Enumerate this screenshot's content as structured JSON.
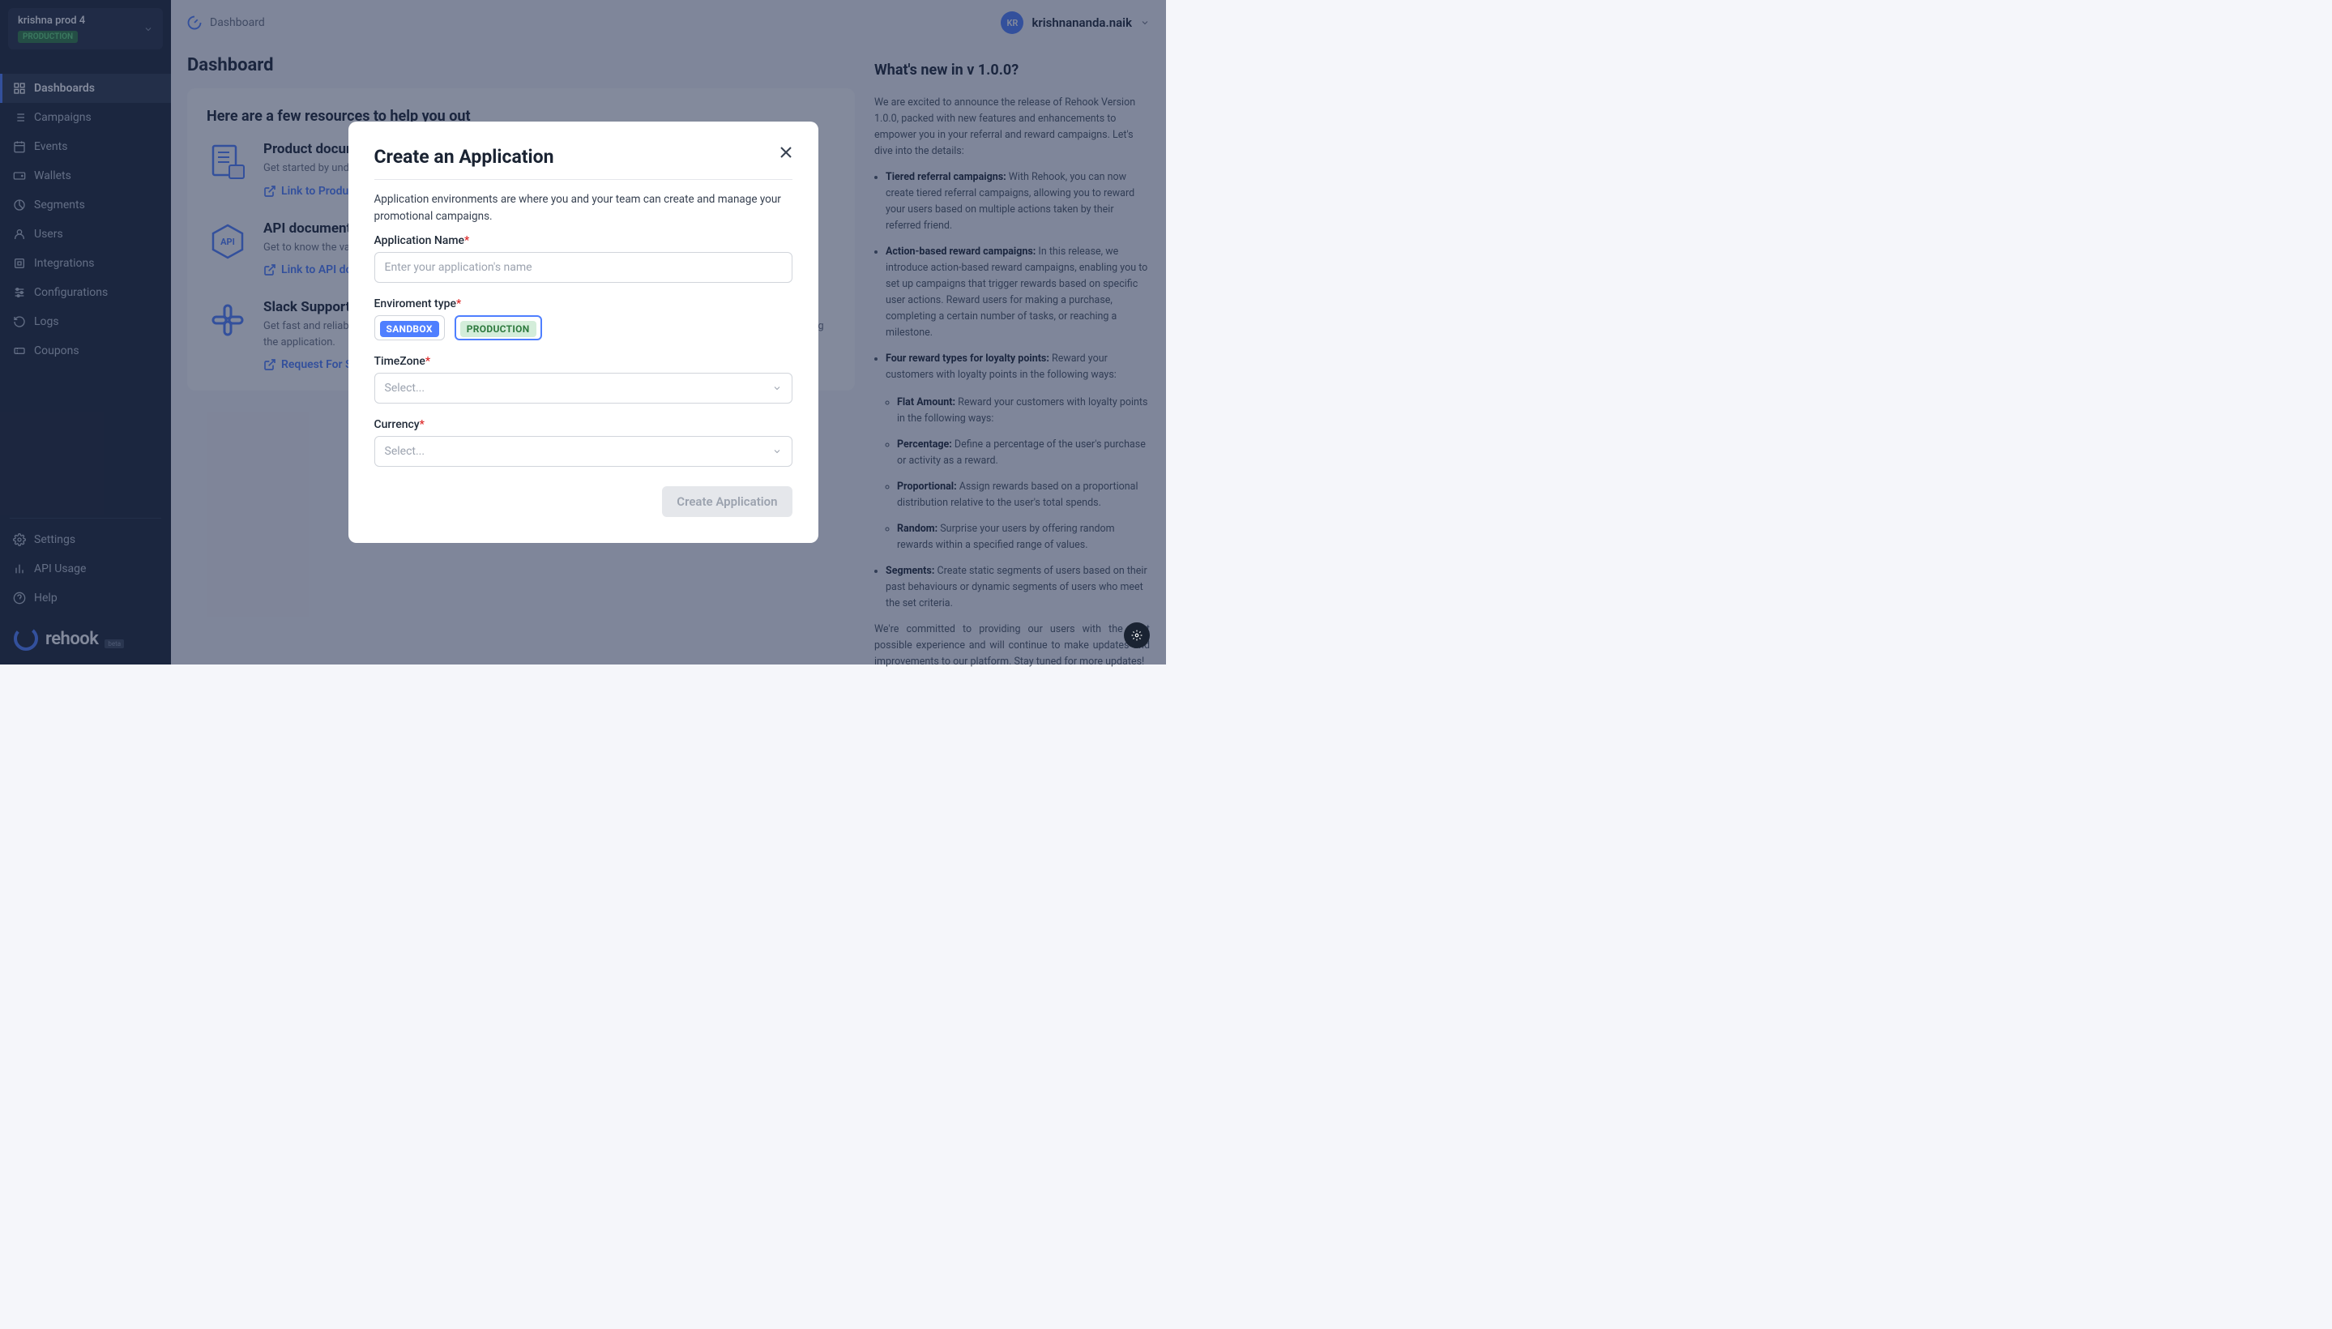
{
  "workspace": {
    "name": "krishna prod 4",
    "env": "PRODUCTION"
  },
  "nav": {
    "items": [
      {
        "label": "Dashboards"
      },
      {
        "label": "Campaigns"
      },
      {
        "label": "Events"
      },
      {
        "label": "Wallets"
      },
      {
        "label": "Segments"
      },
      {
        "label": "Users"
      },
      {
        "label": "Integrations"
      },
      {
        "label": "Configurations"
      },
      {
        "label": "Logs"
      },
      {
        "label": "Coupons"
      }
    ],
    "bottom": [
      {
        "label": "Settings"
      },
      {
        "label": "API Usage"
      },
      {
        "label": "Help"
      }
    ]
  },
  "logo": {
    "text": "rehook",
    "beta": "beta"
  },
  "topbar": {
    "breadcrumb": "Dashboard",
    "user_initials": "KR",
    "user_name": "krishnananda.naik"
  },
  "page": {
    "title": "Dashboard",
    "resources_title": "Here are a few resources to help you out",
    "resources": [
      {
        "title": "Product documentation",
        "desc": "Get started by understanding more about the platform and creating campaigns to start offering rewards.",
        "link": "Link to Product documentation"
      },
      {
        "title": "API documentation",
        "desc": "Get to know the various APIs offered by the platform to push events, check the rewards received, and more.",
        "link": "Link to API documentation"
      },
      {
        "title": "Slack Support",
        "desc": "Get fast and reliable support. Our support team will help you with any blockers or hurdles you may encounter while using the application.",
        "link": "Request For Slack Connect"
      }
    ],
    "news_title": "What's new in v 1.0.0?",
    "news_intro": "We are excited to announce the release of Rehook Version 1.0.0, packed with new features and enhancements to empower you in your referral and reward campaigns. Let's dive into the details:",
    "news_items": [
      {
        "bold": "Tiered referral campaigns:",
        "text": " With Rehook, you can now create tiered referral campaigns, allowing you to reward your users based on multiple actions taken by their referred friend."
      },
      {
        "bold": "Action-based reward campaigns:",
        "text": " In this release, we introduce action-based reward campaigns, enabling you to set up campaigns that trigger rewards based on specific user actions. Reward users for making a purchase, completing a certain number of tasks, or reaching a milestone."
      },
      {
        "bold": "Four reward types for loyalty points:",
        "text": " Reward your customers with loyalty points in the following ways:"
      }
    ],
    "news_sub": [
      {
        "bold": "Flat Amount:",
        "text": " Reward your customers with loyalty points in the following ways:"
      },
      {
        "bold": "Percentage:",
        "text": " Define a percentage of the user's purchase or activity as a reward."
      },
      {
        "bold": "Proportional:",
        "text": " Assign rewards based on a proportional distribution relative to the user's total spends."
      },
      {
        "bold": "Random:",
        "text": " Surprise your users by offering random rewards within a specified range of values."
      }
    ],
    "news_seg": {
      "bold": "Segments:",
      "text": " Create static segments of users based on their past behaviours or dynamic segments of users who meet the set criteria."
    },
    "news_outro": "We're committed to providing our users with the best possible experience and will continue to make updates and improvements to our platform. Stay tuned for more updates!"
  },
  "modal": {
    "title": "Create an Application",
    "desc": "Application environments are where you and your team can create and manage your promotional campaigns.",
    "app_name_label": "Application Name",
    "app_name_placeholder": "Enter your application's name",
    "env_label": "Enviroment type",
    "env_sandbox": "SANDBOX",
    "env_production": "PRODUCTION",
    "tz_label": "TimeZone",
    "tz_placeholder": "Select...",
    "currency_label": "Currency",
    "currency_placeholder": "Select...",
    "submit": "Create Application"
  }
}
